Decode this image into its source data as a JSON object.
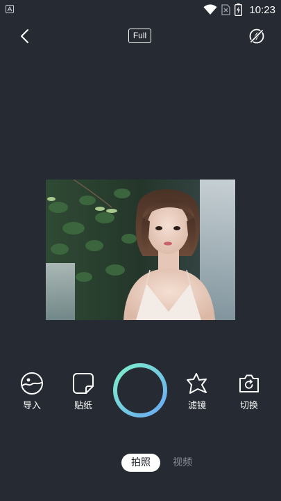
{
  "status_bar": {
    "time": "10:23",
    "icons": [
      "notification-app-icon",
      "wifi-icon",
      "sim-no-signal-icon",
      "battery-charging-icon"
    ]
  },
  "top_bar": {
    "back_icon": "chevron-left-icon",
    "ratio_label": "Full",
    "flash_icon": "flash-off-icon"
  },
  "preview": {
    "description_icon": "camera-preview-image"
  },
  "tools": {
    "import": {
      "label": "导入",
      "icon": "gallery-import-icon"
    },
    "sticker": {
      "label": "贴纸",
      "icon": "sticker-icon"
    },
    "filter": {
      "label": "滤镜",
      "icon": "star-filter-icon"
    },
    "switch": {
      "label": "切换",
      "icon": "switch-camera-icon"
    }
  },
  "shutter": {
    "icon": "shutter-ring-icon",
    "colors": {
      "start": "#7ef0c9",
      "end": "#6aa8f5"
    }
  },
  "modes": {
    "photo": "拍照",
    "video": "视频",
    "selected": "photo"
  },
  "colors": {
    "background": "#262b33",
    "text": "#ffffff",
    "inactive_text": "#8a8f97"
  }
}
